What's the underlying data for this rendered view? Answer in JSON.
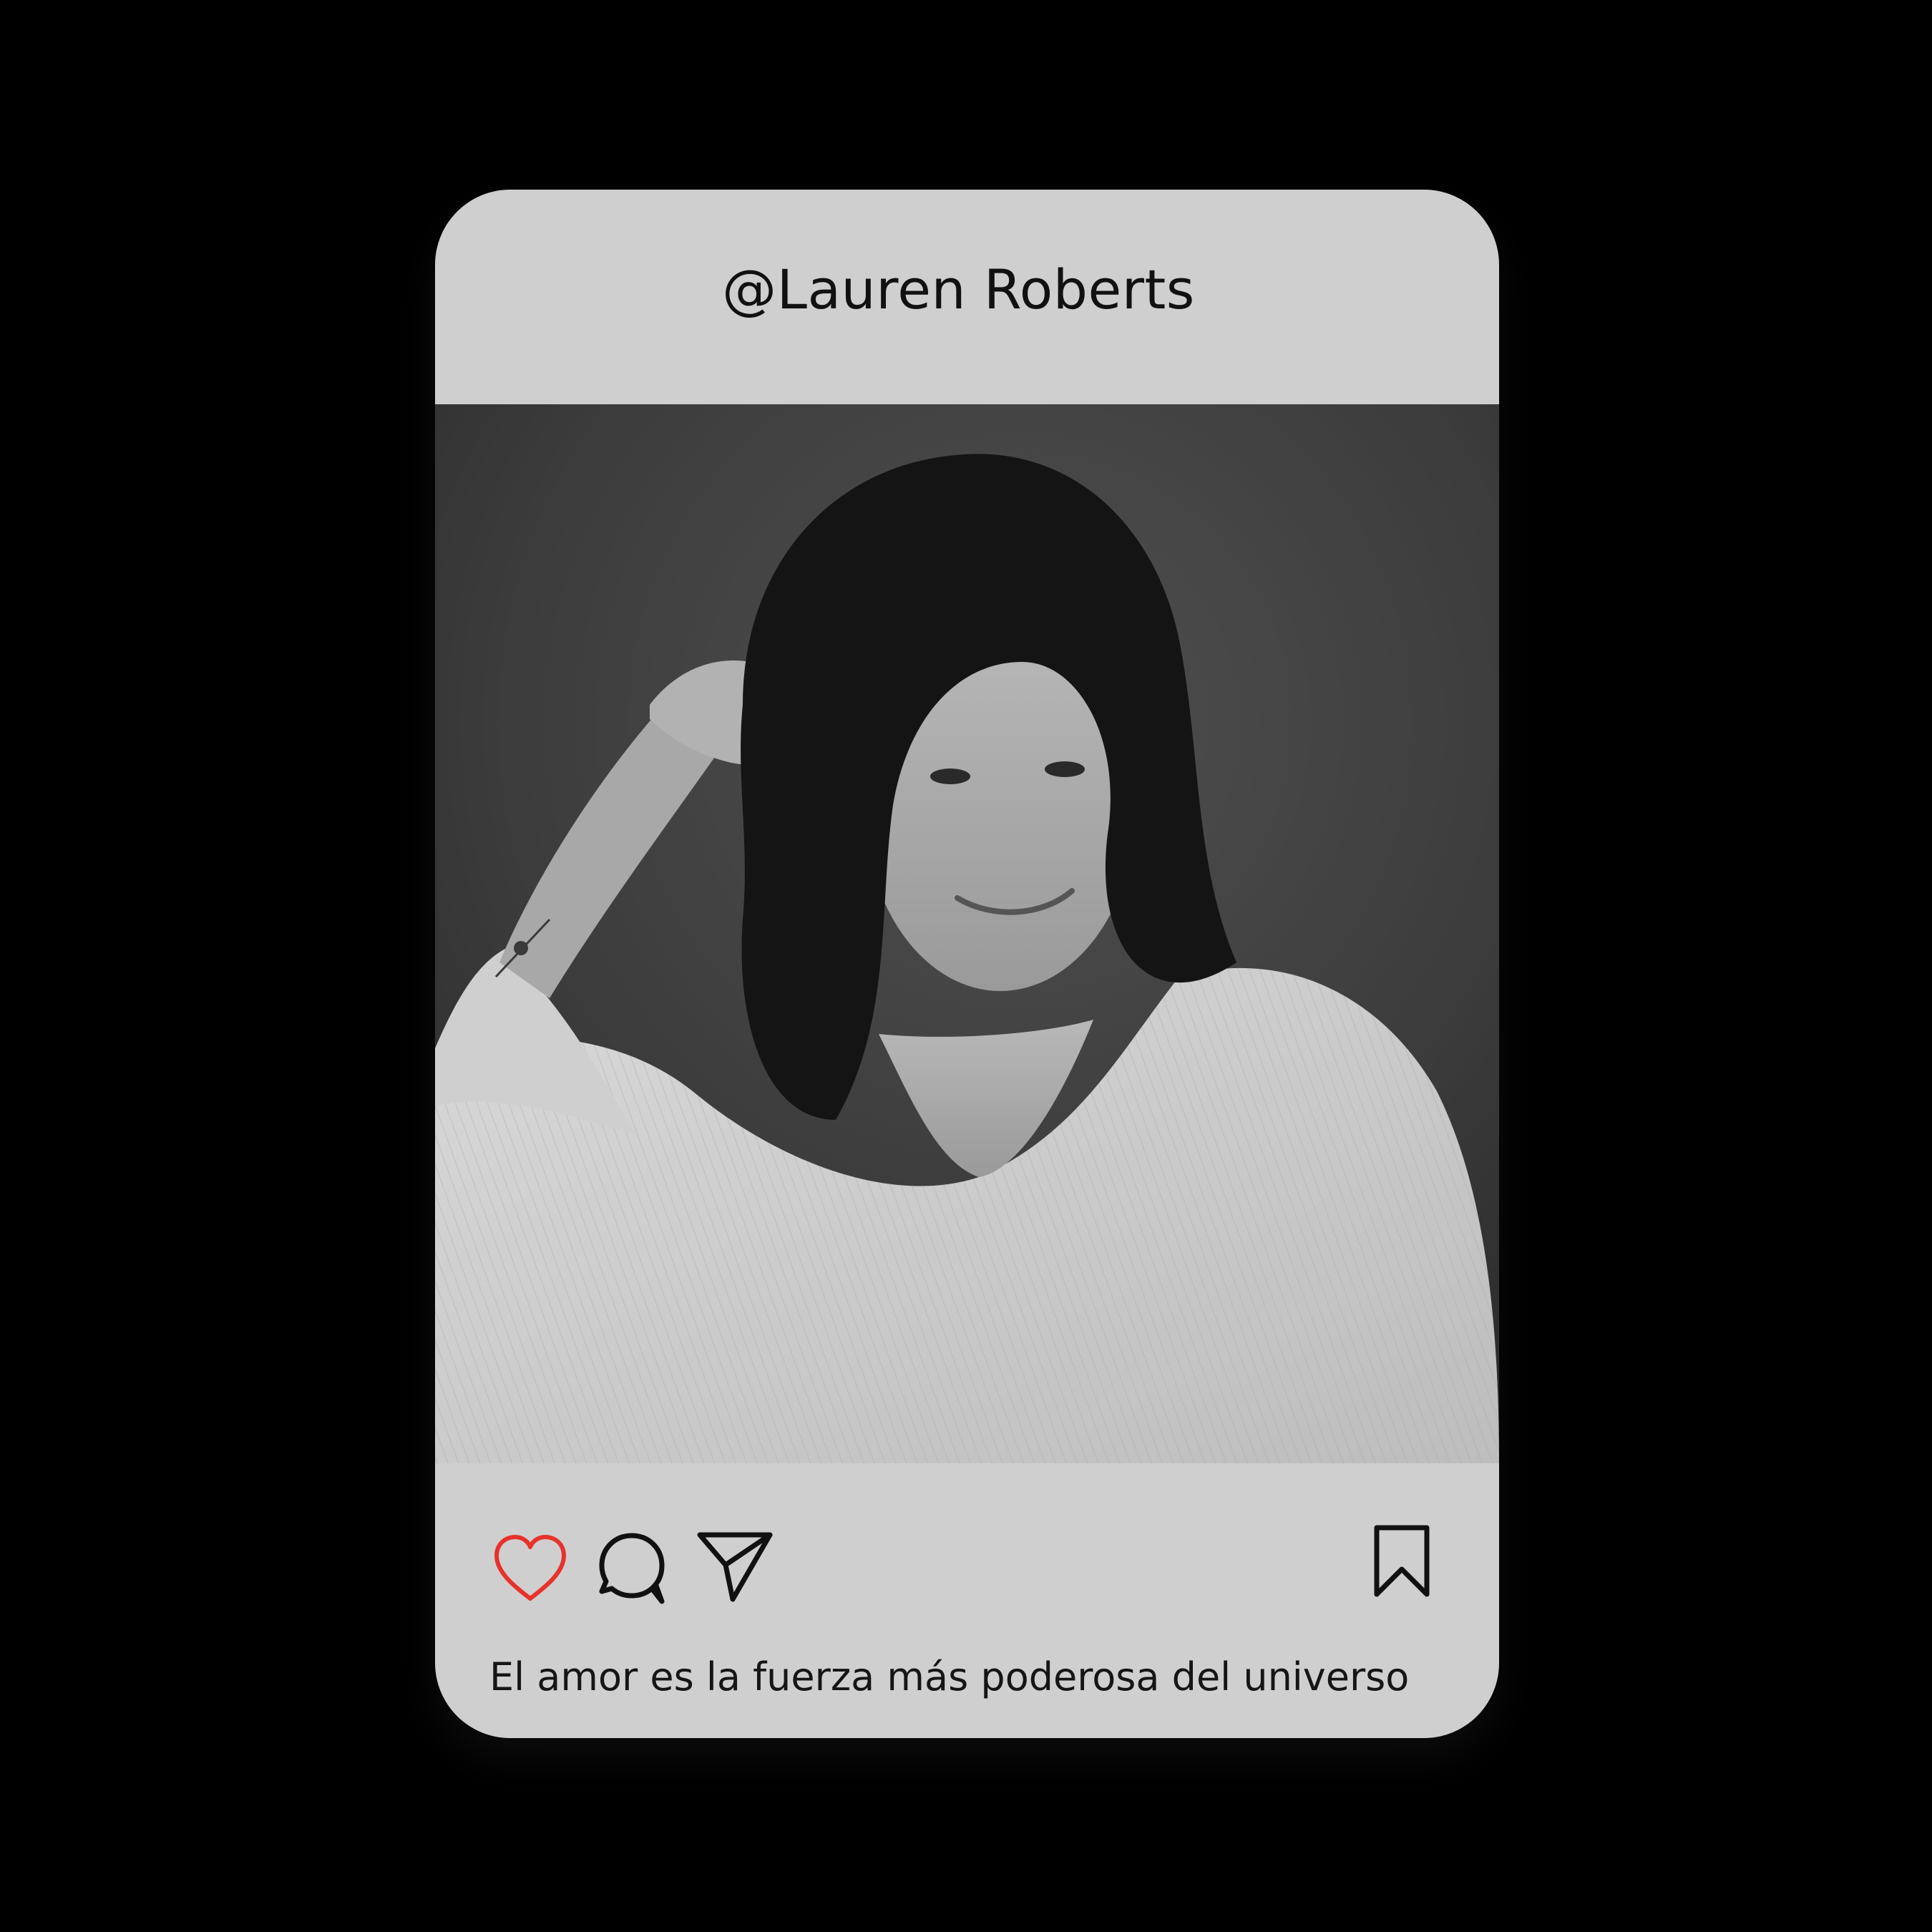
{
  "post": {
    "username": "@Lauren Roberts",
    "caption": "El amor es la fuerza más poderosa del universo",
    "photo_alt": "Black and white portrait photo",
    "liked": true
  },
  "icons": {
    "like": "heart-icon",
    "comment": "speech-bubble-icon",
    "share": "paper-plane-icon",
    "save": "bookmark-icon"
  },
  "colors": {
    "background": "#000000",
    "card": "#cfcfcf",
    "text": "#111111",
    "like_accent": "#e8322b"
  }
}
